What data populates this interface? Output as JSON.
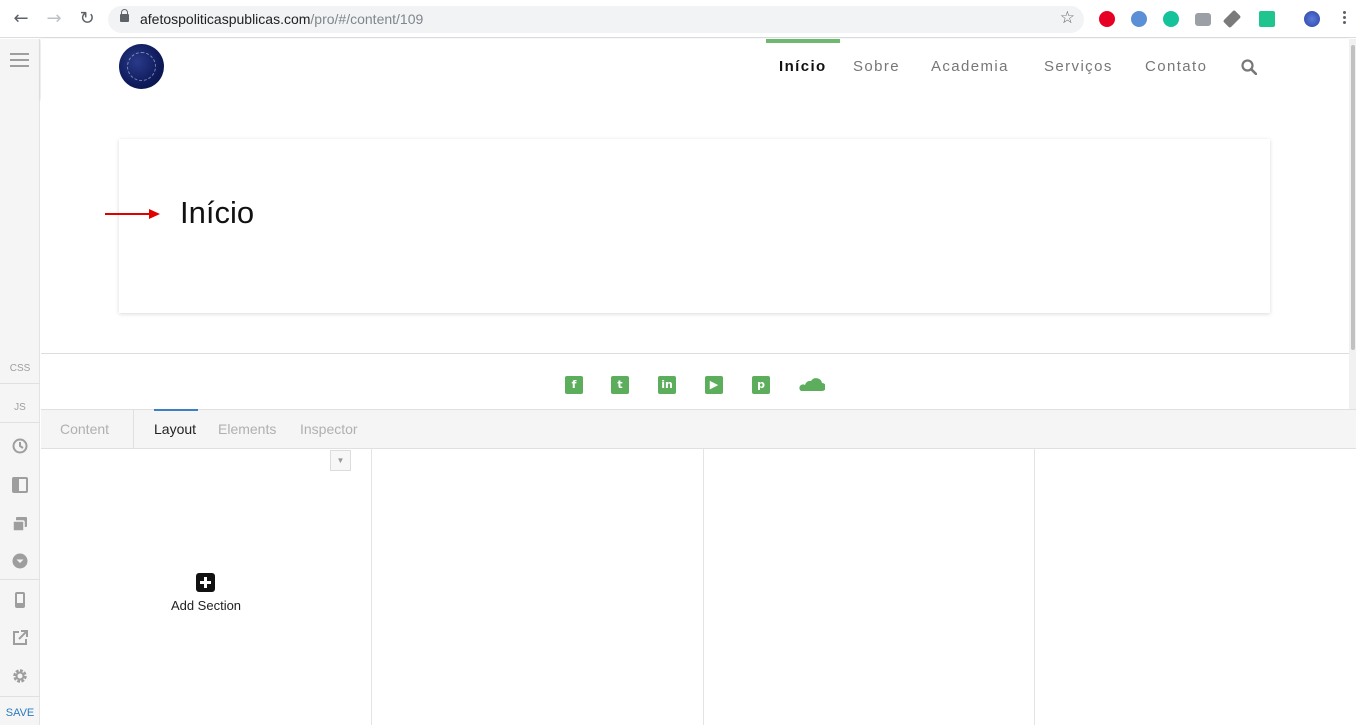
{
  "browser": {
    "url_domain": "afetospoliticaspublicas.com",
    "url_path": "/pro/#/content/109"
  },
  "sidebar": {
    "css_label": "CSS",
    "js_label": "JS",
    "save_label": "SAVE"
  },
  "site": {
    "nav": [
      {
        "label": "Início",
        "active": true
      },
      {
        "label": "Sobre",
        "active": false
      },
      {
        "label": "Academia",
        "active": false
      },
      {
        "label": "Serviços",
        "active": false
      },
      {
        "label": "Contato",
        "active": false
      }
    ],
    "heading": "Início",
    "accent_color": "#6fb86f",
    "social_icons": [
      "facebook-icon",
      "twitter-icon",
      "linkedin-icon",
      "youtube-icon",
      "pinterest-icon",
      "soundcloud-icon"
    ]
  },
  "editor": {
    "tabs": [
      "Content",
      "Layout",
      "Elements",
      "Inspector"
    ],
    "active_tab": "Layout",
    "add_section_label": "Add Section"
  }
}
